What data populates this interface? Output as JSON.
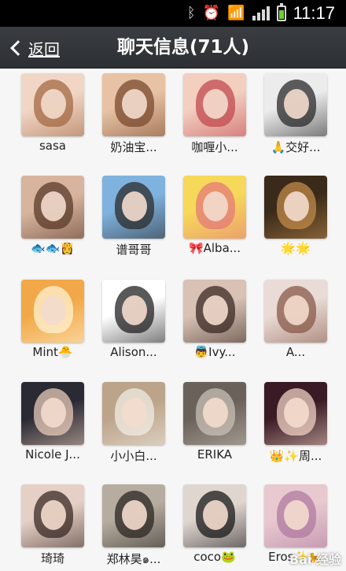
{
  "status_bar": {
    "time": "11:17",
    "icons": [
      "bluetooth-icon",
      "alarm-icon",
      "wifi-icon",
      "signal-icon",
      "battery-icon"
    ]
  },
  "header": {
    "back_label": "返回",
    "title": "聊天信息(71人)"
  },
  "members": [
    {
      "name": "sasa",
      "colors": [
        "#f1d6c6",
        "#a46a43"
      ]
    },
    {
      "name": "奶油宝...",
      "colors": [
        "#e8c2a4",
        "#7a4a2e"
      ]
    },
    {
      "name": "咖喱小...",
      "colors": [
        "#f3cfc0",
        "#c24a4f"
      ]
    },
    {
      "name": "🙏交好...",
      "colors": [
        "#ececec",
        "#2a2a2a"
      ]
    },
    {
      "name": "🐟🐟👸",
      "colors": [
        "#d8b49e",
        "#5a3a2a"
      ]
    },
    {
      "name": "谱哥哥",
      "colors": [
        "#7fb2de",
        "#2b2b2b"
      ]
    },
    {
      "name": "🎀Alba...",
      "colors": [
        "#f6d85a",
        "#e47a7a"
      ]
    },
    {
      "name": "🌟🌟",
      "colors": [
        "#3a2a1a",
        "#c08a4a"
      ]
    },
    {
      "name": "Mint🐣",
      "colors": [
        "#f2a848",
        "#fff2d0"
      ]
    },
    {
      "name": "Alison...",
      "colors": [
        "#ffffff",
        "#222222"
      ]
    },
    {
      "name": "👼Ivy...",
      "colors": [
        "#d9c1b4",
        "#3a2a24"
      ]
    },
    {
      "name": "A...",
      "colors": [
        "#e9dbd6",
        "#8a5a48"
      ]
    },
    {
      "name": "Nicole J...",
      "colors": [
        "#2a2a34",
        "#e8c9b8"
      ]
    },
    {
      "name": "小小白...",
      "colors": [
        "#bca48a",
        "#f0ece4"
      ]
    },
    {
      "name": "ERIKA",
      "colors": [
        "#6a625a",
        "#c8c0b6"
      ]
    },
    {
      "name": "👑✨周...",
      "colors": [
        "#3a1a24",
        "#f0d2c4"
      ]
    },
    {
      "name": "琦琦",
      "colors": [
        "#e6d0c6",
        "#3a2a24"
      ]
    },
    {
      "name": "郑林昊๑...",
      "colors": [
        "#b6ada0",
        "#2a2622"
      ]
    },
    {
      "name": "coco🐸",
      "colors": [
        "#e0d6d0",
        "#1a1a1a"
      ]
    },
    {
      "name": "Eros✨🐆",
      "colors": [
        "#e8c9cf",
        "#b07aa0"
      ]
    }
  ],
  "watermark": "Bai 经验"
}
